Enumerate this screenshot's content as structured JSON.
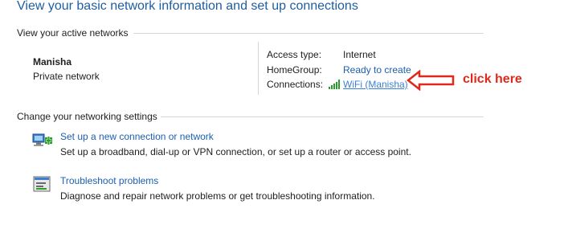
{
  "page": {
    "title": "View your basic network information and set up connections"
  },
  "active_networks": {
    "section_label": "View your active networks",
    "network_name": "Manisha",
    "network_type": "Private network",
    "access_type_label": "Access type:",
    "access_type_value": "Internet",
    "homegroup_label": "HomeGroup:",
    "homegroup_value": "Ready to create",
    "connections_label": "Connections:",
    "connections_value": "WiFi (Manisha)"
  },
  "change_settings": {
    "section_label": "Change your networking settings",
    "items": [
      {
        "title": "Set up a new connection or network",
        "description": "Set up a broadband, dial-up or VPN connection, or set up a router or access point.",
        "icon": "new-connection-icon"
      },
      {
        "title": "Troubleshoot problems",
        "description": "Diagnose and repair network problems or get troubleshooting information.",
        "icon": "troubleshoot-icon"
      }
    ]
  },
  "annotation": {
    "text": "click here",
    "color": "#e1291b"
  },
  "colors": {
    "title": "#1e5e9e",
    "link": "#1c5fae",
    "signal": "#2a9a2a"
  }
}
